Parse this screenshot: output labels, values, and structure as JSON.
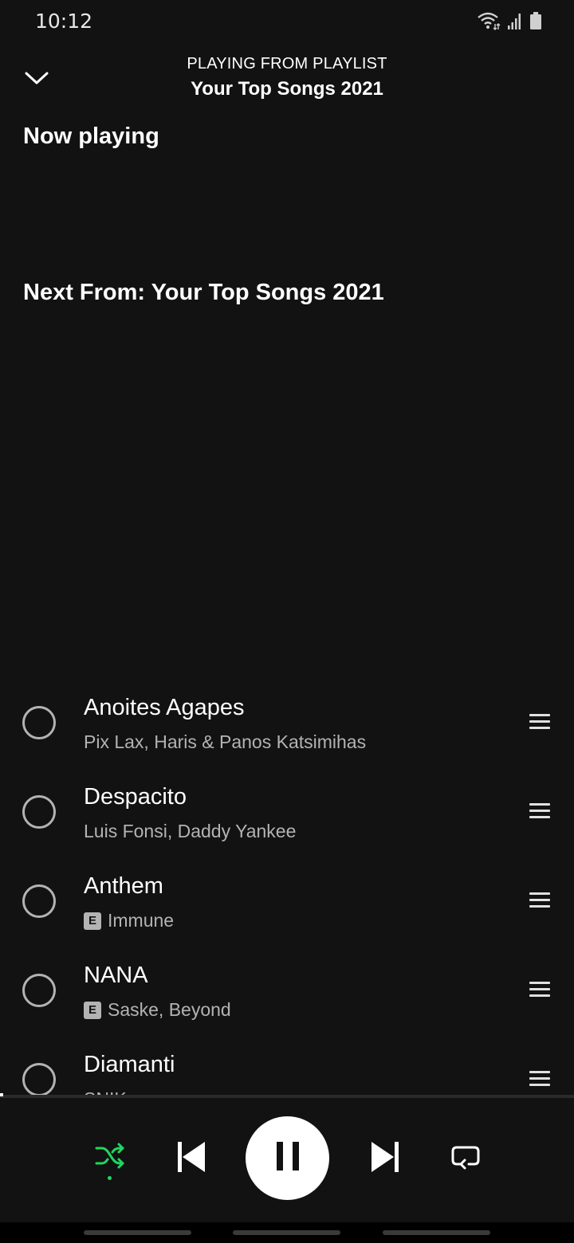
{
  "status_bar": {
    "time": "10:12",
    "icons": [
      "wifi-icon",
      "signal-icon",
      "battery-icon"
    ]
  },
  "header": {
    "context_label": "PLAYING FROM PLAYLIST",
    "playlist_name": "Your Top Songs 2021",
    "collapse_icon": "chevron-down-icon"
  },
  "sections": {
    "now_playing": "Now playing",
    "next_from": "Next From: Your Top Songs 2021"
  },
  "queue": [
    {
      "title": "Anoites Agapes",
      "artist": "Pix Lax, Haris & Panos Katsimihas",
      "explicit": false,
      "explicit_label": ""
    },
    {
      "title": "Despacito",
      "artist": "Luis Fonsi, Daddy Yankee",
      "explicit": false,
      "explicit_label": ""
    },
    {
      "title": "Anthem",
      "artist": "Immune",
      "explicit": true,
      "explicit_label": "E"
    },
    {
      "title": "NANA",
      "artist": "Saske, Beyond",
      "explicit": true,
      "explicit_label": "E"
    },
    {
      "title": "Diamanti",
      "artist": "SNIK",
      "explicit": false,
      "explicit_label": ""
    }
  ],
  "controls": {
    "shuffle_icon": "shuffle-icon",
    "previous_icon": "skip-previous-icon",
    "pause_icon": "pause-icon",
    "next_icon": "skip-next-icon",
    "repeat_icon": "repeat-icon",
    "shuffle_active": true
  },
  "colors": {
    "background": "#121212",
    "accent": "#1ed760",
    "text_primary": "#ffffff",
    "text_secondary": "#b3b3b3"
  }
}
